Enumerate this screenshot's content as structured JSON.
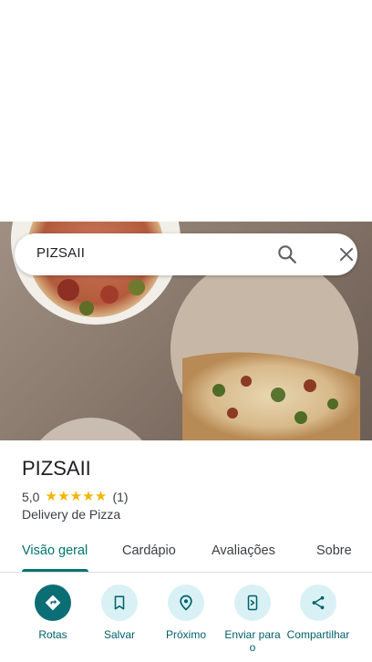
{
  "search": {
    "query": "PIZSAII"
  },
  "place": {
    "name": "PIZSAII",
    "rating": "5,0",
    "stars": 5,
    "review_count": "(1)",
    "category": "Delivery de Pizza"
  },
  "tabs": [
    {
      "label": "Visão geral",
      "active": true
    },
    {
      "label": "Cardápio",
      "active": false
    },
    {
      "label": "Avaliações",
      "active": false
    },
    {
      "label": "Sobre",
      "active": false
    }
  ],
  "actions": [
    {
      "label": "Rotas",
      "icon": "directions-icon"
    },
    {
      "label": "Salvar",
      "icon": "bookmark-icon"
    },
    {
      "label": "Próximo",
      "icon": "nearby-icon"
    },
    {
      "label": "Enviar para o",
      "icon": "send-to-phone-icon"
    },
    {
      "label": "Compartilhar",
      "icon": "share-icon"
    }
  ],
  "colors": {
    "accent": "#00756d",
    "star": "#f4b400",
    "action_bg": "#d9f1f5",
    "primary_action_bg": "#0b6e74"
  }
}
